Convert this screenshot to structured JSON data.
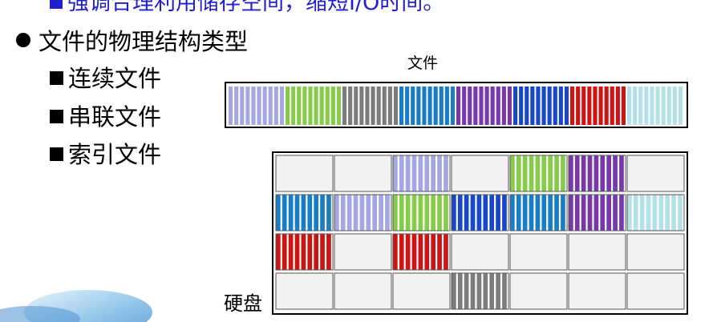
{
  "top_line": "强调合理利用储存空间，缩短I/O时间。",
  "heading": "文件的物理结构类型",
  "items": [
    "连续文件",
    "串联文件",
    "索引文件"
  ],
  "file_label": "文件",
  "disk_label": "硬盘",
  "colors": {
    "lavender": "#a6a6e0",
    "green": "#86cc4a",
    "gray": "#7c7c7c",
    "teal_blue": "#1a7cc4",
    "purple": "#7838a8",
    "blue": "#1848c8",
    "red": "#cc1414",
    "light_cyan": "#b4e0e8",
    "empty_block": "#f2f2f2"
  },
  "file_segments": [
    "lavender",
    "green",
    "gray",
    "teal_blue",
    "purple",
    "blue",
    "red",
    "light_cyan"
  ],
  "disk_blocks": [
    [
      "empty",
      "empty",
      "lavender",
      "empty",
      "green",
      "purple",
      "empty"
    ],
    [
      "teal_blue",
      "lavender",
      "green",
      "blue",
      "teal_blue",
      "purple",
      "light_cyan"
    ],
    [
      "red",
      "empty",
      "red",
      "empty",
      "empty",
      "empty",
      "empty"
    ],
    [
      "empty",
      "empty",
      "empty",
      "gray",
      "empty",
      "empty",
      "empty"
    ]
  ]
}
